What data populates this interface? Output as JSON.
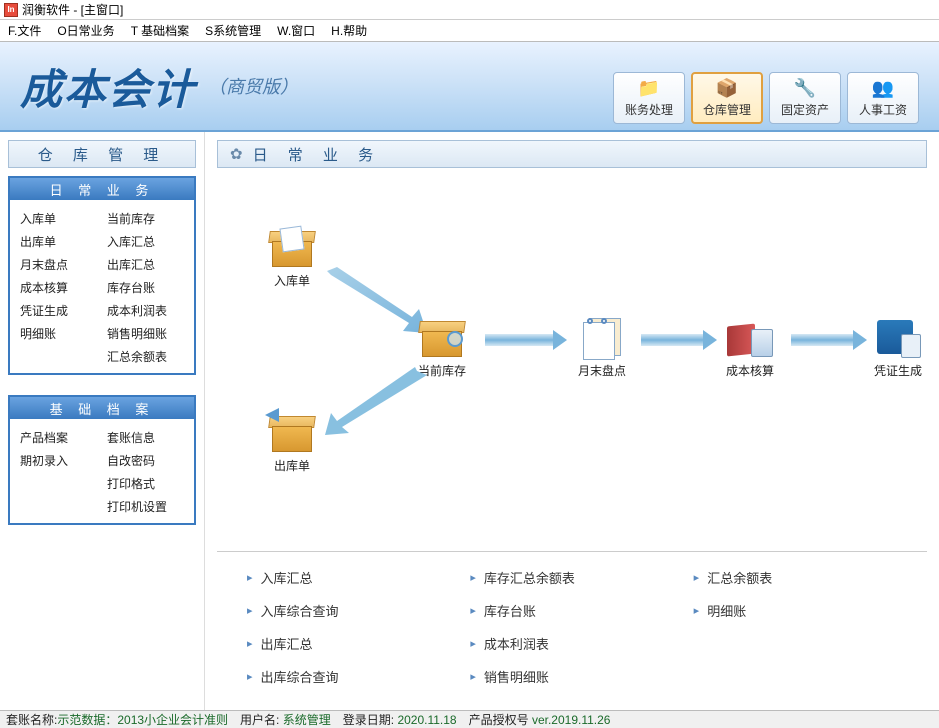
{
  "titlebar": {
    "text": "润衡软件 - [主窗口]"
  },
  "menu": [
    "F.文件",
    "O日常业务",
    "T 基础档案",
    "S系统管理",
    "W.窗口",
    "H.帮助"
  ],
  "banner": {
    "title": "成本会计",
    "subtitle": "（商贸版）",
    "buttons": [
      {
        "label": "账务处理",
        "icon": "📁"
      },
      {
        "label": "仓库管理",
        "icon": "📦",
        "active": true
      },
      {
        "label": "固定资产",
        "icon": "🔧"
      },
      {
        "label": "人事工资",
        "icon": "👥"
      }
    ]
  },
  "sidebar": {
    "title": "仓 库 管 理",
    "panel1": {
      "header": "日 常 业 务",
      "items": [
        "入库单",
        "当前库存",
        "出库单",
        "入库汇总",
        "月末盘点",
        "出库汇总",
        "成本核算",
        "库存台账",
        "凭证生成",
        "成本利润表",
        "明细账",
        "销售明细账",
        "",
        "汇总余额表"
      ]
    },
    "panel2": {
      "header": "基 础 档 案",
      "items": [
        "产品档案",
        "套账信息",
        "期初录入",
        "自改密码",
        "",
        "打印格式",
        "",
        "打印机设置"
      ]
    }
  },
  "main": {
    "title": "日 常 业 务",
    "nodes": {
      "n1": "入库单",
      "n2": "当前库存",
      "n3": "出库单",
      "n4": "月末盘点",
      "n5": "成本核算",
      "n6": "凭证生成"
    },
    "links": [
      "入库汇总",
      "库存汇总余额表",
      "汇总余额表",
      "入库综合查询",
      "库存台账",
      "明细账",
      "出库汇总",
      "成本利润表",
      "出库综合查询",
      "销售明细账"
    ]
  },
  "status": {
    "k1": "套账名称:",
    "v1": "示范数据：2013小企业会计准则",
    "k2": "用户名:",
    "v2": "系统管理",
    "k3": "登录日期:",
    "v3": "2020.11.18",
    "k4": "产品授权号",
    "v4": "ver.2019.11.26"
  }
}
